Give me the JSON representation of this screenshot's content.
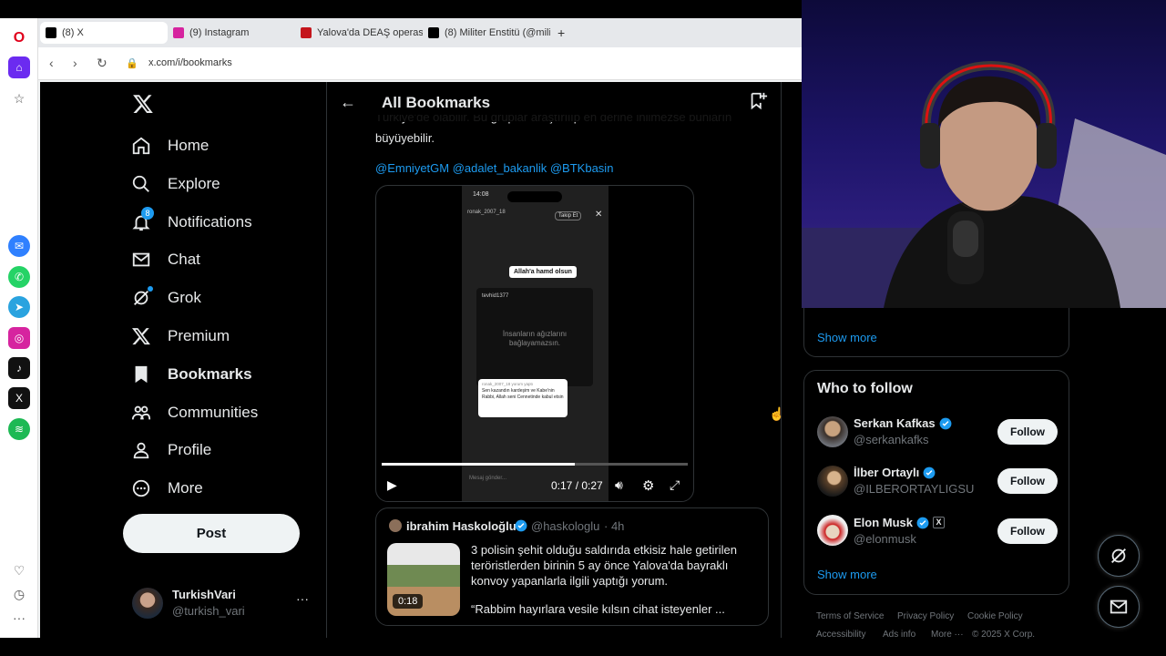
{
  "browser": {
    "tabs": [
      {
        "label": "(8) X",
        "active": true,
        "favicon": "x-icon"
      },
      {
        "label": "(9) Instagram",
        "active": false,
        "favicon": "instagram-icon"
      },
      {
        "label": "Yalova'da DEAŞ operasyonu",
        "active": false,
        "favicon": "h-icon"
      },
      {
        "label": "(8) Militer Enstitü (@militer",
        "active": false,
        "favicon": "x-icon"
      }
    ],
    "new_tab": "+",
    "url": "x.com/i/bookmarks"
  },
  "nav": {
    "home": "Home",
    "explore": "Explore",
    "notifications": "Notifications",
    "notifications_badge": "8",
    "chat": "Chat",
    "grok": "Grok",
    "premium": "Premium",
    "bookmarks": "Bookmarks",
    "communities": "Communities",
    "profile": "Profile",
    "more": "More",
    "post": "Post"
  },
  "account": {
    "name": "TurkishVari",
    "handle": "@turkish_vari",
    "menu": "···"
  },
  "header": {
    "title": "All Bookmarks"
  },
  "tweet": {
    "text_line1": "Türkiye'de olabilir. Bu gruplar araştırılıp en derine inilmezse bunların kitlesel",
    "text_line2": "büyüyebilir.",
    "mentions": "@EmniyetGM @adalet_bakanlik @BTKbasin",
    "video": {
      "time": "0:17 / 0:27",
      "progress": 0.63,
      "phone_time": "14:08",
      "story_user": "ronak_2007_18",
      "story_caption": "Allah'a hamd olsun",
      "inner_user": "tevhid1377",
      "inner_text": "İnsanların ağızlarını bağlayamazsın.",
      "reply_header": "ronak_2007_18 yorum yaptı",
      "reply_text": "Sen kazandın kardeşim ve Kabe'nin Rabbi, Allah seni Cennetinde kabul etsin",
      "message_placeholder": "Mesaj gönder..."
    }
  },
  "quote": {
    "author": "ibrahim Haskoloğlu",
    "handle": "@haskologlu",
    "time": "· 4h",
    "thumb_duration": "0:18",
    "text": "3 polisin şehit olduğu saldırıda etkisiz hale getirilen teröristlerden birinin 5 ay önce Yalova'da bayraklı konvoy yapanlarla ilgili yaptığı yorum.",
    "text2": "“Rabbim hayırlara vesile kılsın cihat isteyenler ..."
  },
  "sidebar": {
    "show_more_top": "Show more",
    "who_to_follow": "Who to follow",
    "suggestions": [
      {
        "name": "Serkan Kafkas",
        "handle": "@serkankafks",
        "button": "Follow"
      },
      {
        "name": "İlber Ortaylı",
        "handle": "@ILBERORTAYLIGSU",
        "button": "Follow"
      },
      {
        "name": "Elon Musk",
        "handle": "@elonmusk",
        "button": "Follow"
      }
    ],
    "show_more": "Show more",
    "footer": {
      "terms": "Terms of Service",
      "privacy": "Privacy Policy",
      "cookie": "Cookie Policy",
      "accessibility": "Accessibility",
      "ads": "Ads info",
      "more": "More ···",
      "copyright": "© 2025 X Corp."
    }
  },
  "colors": {
    "accent": "#1d9bf0",
    "background": "#000000",
    "border": "#2f3336",
    "muted": "#71767b"
  }
}
